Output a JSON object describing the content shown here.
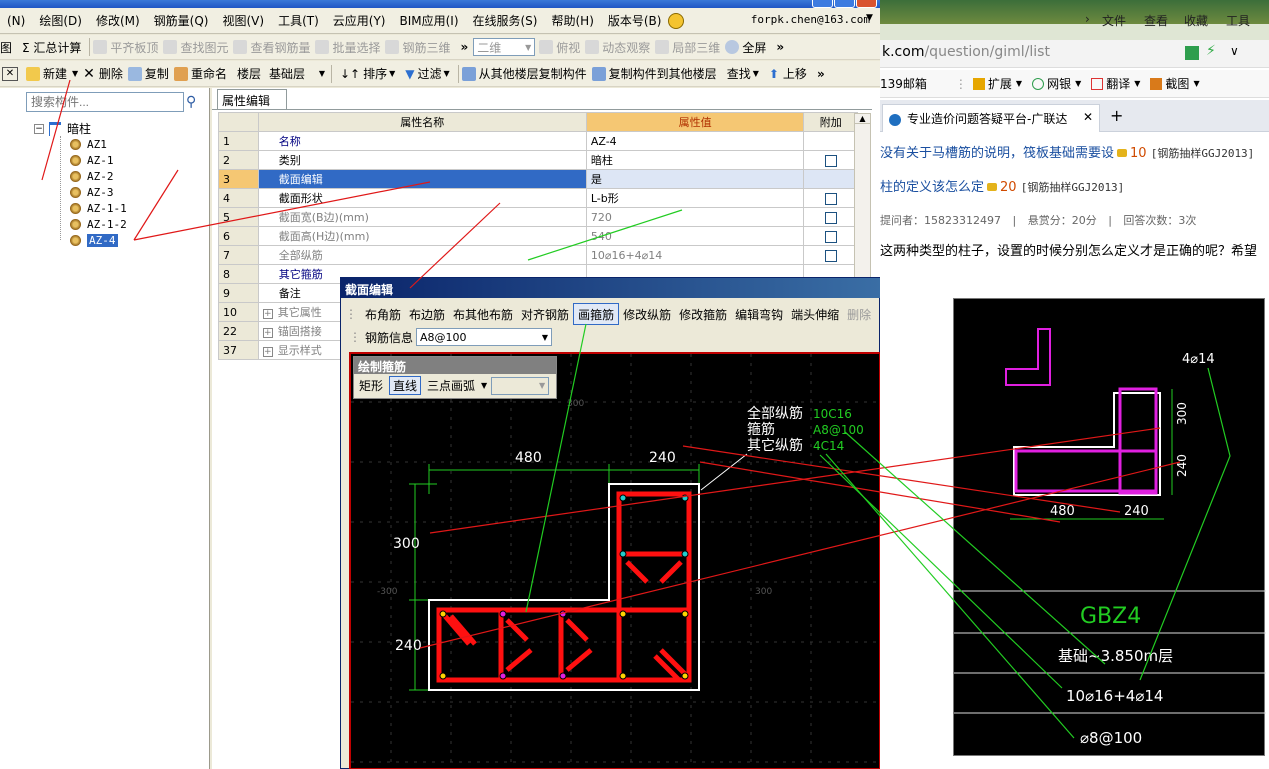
{
  "menu": {
    "items": [
      "(N)",
      "绘图(D)",
      "修改(M)",
      "钢筋量(Q)",
      "视图(V)",
      "工具(T)",
      "云应用(Y)",
      "BIM应用(I)",
      "在线服务(S)",
      "帮助(H)",
      "版本号(B)"
    ],
    "user": "forpk.chen@163.com"
  },
  "toolbar1": {
    "items": [
      {
        "label": "图",
        "enabled": true
      },
      {
        "label": "Σ 汇总计算",
        "enabled": true
      },
      {
        "label": "平齐板顶",
        "enabled": false
      },
      {
        "label": "查找图元",
        "enabled": false
      },
      {
        "label": "查看钢筋量",
        "enabled": false
      },
      {
        "label": "批量选择",
        "enabled": false
      },
      {
        "label": "钢筋三维",
        "enabled": false
      },
      {
        "label": "二维",
        "enabled": false
      },
      {
        "label": "俯视",
        "enabled": false
      },
      {
        "label": "动态观察",
        "enabled": false
      },
      {
        "label": "局部三维",
        "enabled": false
      },
      {
        "label": "全屏",
        "enabled": true
      }
    ]
  },
  "toolbar2": {
    "new_label": "新建",
    "delete_label": "删除",
    "copy_label": "复制",
    "rename_label": "重命名",
    "floor_label": "楼层",
    "floor_value": "基础层",
    "sort_label": "排序",
    "filter_label": "过滤",
    "copy_from_label": "从其他楼层复制构件",
    "copy_to_label": "复制构件到其他楼层",
    "find_label": "查找",
    "up_label": "上移"
  },
  "left": {
    "search_placeholder": "搜索构件...",
    "root": "暗柱",
    "items": [
      "AZ1",
      "AZ-1",
      "AZ-2",
      "AZ-3",
      "AZ-1-1",
      "AZ-1-2",
      "AZ-4"
    ],
    "selected": "AZ-4"
  },
  "props": {
    "tab": "属性编辑",
    "col_name": "属性名称",
    "col_value": "属性值",
    "col_extra": "附加",
    "rows": [
      {
        "num": "1",
        "name": "名称",
        "value": "AZ-4",
        "check": false
      },
      {
        "num": "2",
        "name": "类别",
        "value": "暗柱",
        "check": true
      },
      {
        "num": "3",
        "name": "截面编辑",
        "value": "是",
        "check": false
      },
      {
        "num": "4",
        "name": "截面形状",
        "value": "L-b形",
        "check": true
      },
      {
        "num": "5",
        "name": "截面宽(B边)(mm)",
        "value": "720",
        "check": true
      },
      {
        "num": "6",
        "name": "截面高(H边)(mm)",
        "value": "540",
        "check": true
      },
      {
        "num": "7",
        "name": "全部纵筋",
        "value": "10⌀16+4⌀14",
        "check": true
      },
      {
        "num": "8",
        "name": "其它箍筋",
        "value": "",
        "check": false
      },
      {
        "num": "9",
        "name": "备注",
        "value": "",
        "check": false
      },
      {
        "num": "10",
        "name": "其它属性",
        "value": "",
        "check": false
      },
      {
        "num": "22",
        "name": "锚固搭接",
        "value": "",
        "check": false
      },
      {
        "num": "37",
        "name": "显示样式",
        "value": "",
        "check": false
      }
    ]
  },
  "dialog": {
    "title": "截面编辑",
    "tools": [
      "布角筋",
      "布边筋",
      "布其他布筋",
      "对齐钢筋",
      "画箍筋",
      "修改纵筋",
      "修改箍筋",
      "编辑弯钩",
      "端头伸缩",
      "删除"
    ],
    "active_tool": "画箍筋",
    "rebar_label": "钢筋信息",
    "rebar_value": "A8@100",
    "palette_title": "绘制箍筋",
    "palette_items": [
      "矩形",
      "直线",
      "三点画弧"
    ],
    "palette_active": "直线",
    "legend": [
      {
        "label": "全部纵筋",
        "value": "10C16"
      },
      {
        "label": "箍筋",
        "value": "A8@100"
      },
      {
        "label": "其它纵筋",
        "value": "4C14"
      }
    ],
    "dims": {
      "w1": "480",
      "w2": "240",
      "h1": "300",
      "h2": "240"
    },
    "grid_labels": {
      "top": "300",
      "left": "-300",
      "right": "300"
    }
  },
  "browser": {
    "menu": [
      "文件",
      "查看",
      "收藏",
      "工具"
    ],
    "url_prefix": "k.com",
    "url_path": "/question/giml/list",
    "bookmarks": [
      "139邮箱",
      "扩展",
      "网银",
      "翻译",
      "截图"
    ],
    "tab_title": "专业造价问题答疑平台-广联达",
    "q1_text": "没有关于马槽筋的说明，筏板基础需要设",
    "q1_points": "10",
    "q1_tag": "[钢筋抽样GGJ2013]",
    "q2_text": "柱的定义该怎么定",
    "q2_points": "20",
    "q2_tag": "[钢筋抽样GGJ2013]",
    "meta_asker": "提问者：15823312497",
    "meta_bounty": "悬赏分：20分",
    "meta_answers": "回答次数：3次",
    "body": "这两种类型的柱子，设置的时候分别怎么定义才是正确的呢？希望",
    "photo": {
      "dim_top": "4⌀14",
      "dim_300": "300",
      "dim_240v": "240",
      "dim_480": "480",
      "dim_240h": "240",
      "name": "GBZ4",
      "level": "基础~3.850m层",
      "rebar": "10⌀16+4⌀14",
      "stirrup": "⌀8@100"
    }
  },
  "colors": {
    "accent": "#316ac5",
    "rebar": "#ff1010",
    "annot_red": "#e01818",
    "annot_green": "#22cc22",
    "magenta": "#e020e0"
  }
}
